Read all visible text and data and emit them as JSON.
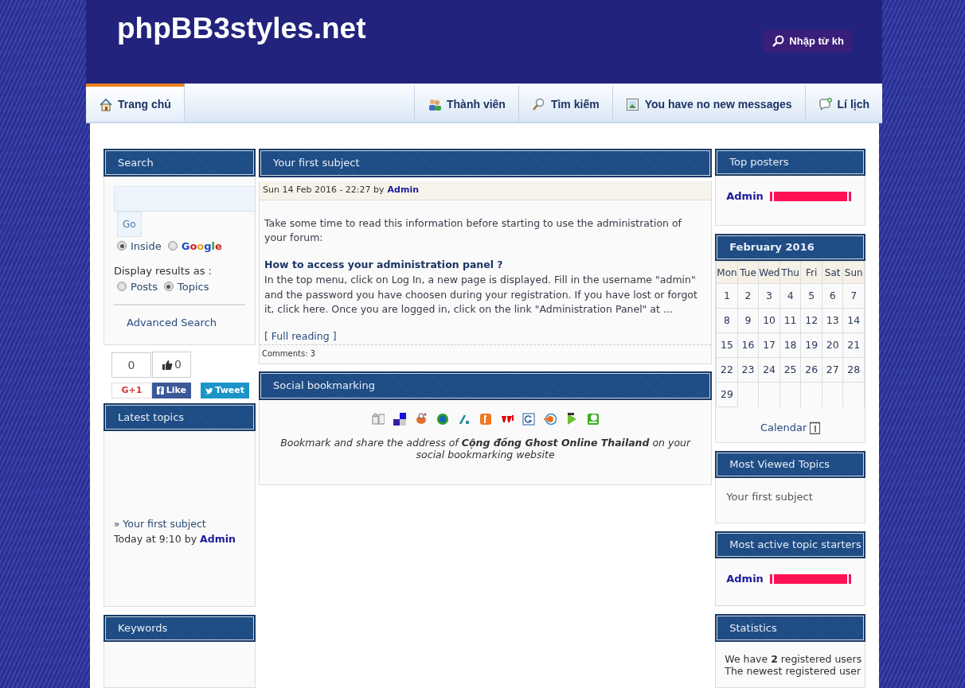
{
  "header": {
    "site_title": "phpBB3styles.net",
    "search_button": "Nhập từ kh"
  },
  "nav": [
    {
      "label": "Trang chủ",
      "selected": true
    },
    {
      "label": "Thành viên",
      "selected": false
    },
    {
      "label": "Tìm kiếm",
      "selected": false
    },
    {
      "label": "You have no new messages",
      "selected": false
    },
    {
      "label": "Lí lịch",
      "selected": false
    }
  ],
  "search_panel": {
    "title": "Search",
    "button": "Go",
    "engines": [
      {
        "label": "Inside",
        "selected": true
      },
      {
        "label": "Google",
        "selected": false
      }
    ],
    "display_label": "Display results as :",
    "display_options": [
      {
        "label": "Posts",
        "selected": false
      },
      {
        "label": "Topics",
        "selected": true
      }
    ],
    "advanced_link": "Advanced Search"
  },
  "social_buttons": [
    {
      "kind": "gplus",
      "count": "0",
      "label": "G+1"
    },
    {
      "kind": "facebook",
      "count": "0",
      "label": "Like"
    },
    {
      "kind": "twitter",
      "label": "Tweet"
    }
  ],
  "latest_topics": {
    "title": "Latest topics",
    "items": [
      {
        "prefix": "»",
        "topic": "Your first subject",
        "meta": "Today at 9:10 by",
        "author": "Admin"
      }
    ]
  },
  "keywords": {
    "title": "Keywords"
  },
  "post": {
    "title": "Your first subject",
    "date": "Sun 14 Feb 2016 - 22:27 by",
    "author": "Admin",
    "intro": "Take some time to read this information before starting to use the administration of your forum:",
    "heading": "How to access your administration panel ?",
    "body": "In the top menu, click on Log In, a new page is displayed. Fill in the username \"admin\" and the password you have choosen during your registration. If you have lost or forgot it, click here. Once you are logged in, click on the link \"Administration Panel\" at ...",
    "read_more": "[ Full reading ]",
    "comments": "Comments: 3"
  },
  "bookmarking": {
    "title": "Social bookmarking",
    "text": "Bookmark and share the address of **Cộng đồng Ghost Online Thailand** on your social bookmarking website"
  },
  "top_posters": {
    "title": "Top posters",
    "users": [
      {
        "name": "Admin",
        "level": 1
      }
    ]
  },
  "calendar": {
    "title": "February 2016",
    "weekdays": [
      "Mon",
      "Tue",
      "Wed",
      "Thu",
      "Fri",
      "Sat",
      "Sun"
    ],
    "weeks": [
      [
        "1",
        "2",
        "3",
        "4",
        "5",
        "6",
        "7"
      ],
      [
        "8",
        "9",
        "10",
        "11",
        "12",
        "13",
        "14"
      ],
      [
        "15",
        "16",
        "17",
        "18",
        "19",
        "20",
        "21"
      ],
      [
        "22",
        "23",
        "24",
        "25",
        "26",
        "27",
        "28"
      ],
      [
        "29"
      ]
    ],
    "link": "Calendar"
  },
  "most_viewed": {
    "title": "Most Viewed Topics",
    "items": [
      "Your first subject"
    ]
  },
  "most_active": {
    "title": "Most active topic starters",
    "users": [
      {
        "name": "Admin",
        "level": 1
      }
    ]
  },
  "statistics": {
    "title": "Statistics",
    "lines": [
      "We have **2** registered users",
      "The newest registered user"
    ]
  }
}
